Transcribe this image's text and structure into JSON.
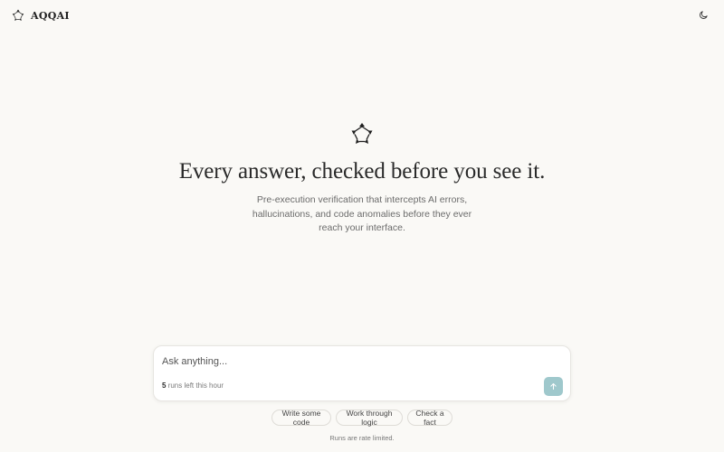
{
  "header": {
    "brand_name": "AQQAI",
    "brand_icon": "aqqai-logo-icon",
    "theme_icon": "moon-icon"
  },
  "hero": {
    "logo_icon": "aqqai-logo-icon",
    "title": "Every answer, checked before you see it.",
    "subtitle": "Pre-execution verification that intercepts AI errors, hallucinations, and code anomalies before they ever reach your interface."
  },
  "prompt": {
    "placeholder": "Ask anything...",
    "value": "",
    "runs_count": "5",
    "runs_text": "runs left this hour",
    "send_icon": "arrow-up-icon",
    "send_color": "#9fc8cc"
  },
  "suggestions": [
    {
      "label": "Write some code"
    },
    {
      "label": "Work through logic"
    },
    {
      "label": "Check a fact"
    }
  ],
  "footnote": "Runs are rate limited.",
  "colors": {
    "background": "#faf9f6",
    "card": "#ffffff",
    "accent": "#9fc8cc"
  }
}
